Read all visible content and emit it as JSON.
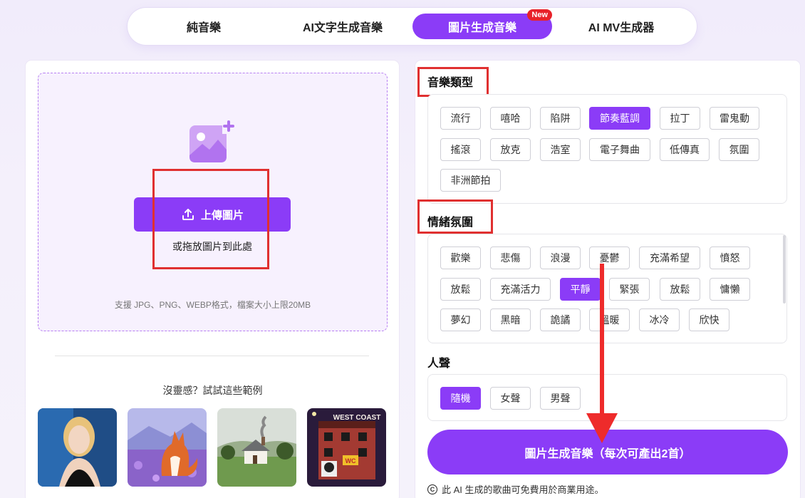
{
  "tabs": [
    {
      "label": "純音樂"
    },
    {
      "label": "AI文字生成音樂"
    },
    {
      "label": "圖片生成音樂",
      "badge": "New"
    },
    {
      "label": "AI MV生成器"
    }
  ],
  "upload": {
    "button_label": "上傳圖片",
    "drag_text": "或拖放圖片到此處",
    "support_text": "支援 JPG、PNG、WEBP格式，檔案大小上限20MB"
  },
  "inspiration": {
    "title": "沒靈感？試試這些範例",
    "thumb4_sign": "WEST COAST",
    "thumb4_tag": "WC"
  },
  "genre": {
    "title": "音樂類型",
    "chips": [
      "流行",
      "嘻哈",
      "陷阱",
      "節奏藍調",
      "拉丁",
      "雷鬼動",
      "搖滾",
      "放克",
      "浩室",
      "電子舞曲",
      "低傳真",
      "氛圍",
      "非洲節拍"
    ],
    "selected": "節奏藍調"
  },
  "mood": {
    "title": "情緒氛圍",
    "chips": [
      "歡樂",
      "悲傷",
      "浪漫",
      "憂鬱",
      "充滿希望",
      "憤怒",
      "放鬆",
      "充滿活力",
      "平靜",
      "緊張",
      "放鬆",
      "慵懶",
      "夢幻",
      "黑暗",
      "詭譎",
      "溫暖",
      "冰冷",
      "欣快"
    ],
    "selected": "平靜"
  },
  "vocal": {
    "title": "人聲",
    "chips": [
      "隨機",
      "女聲",
      "男聲"
    ],
    "selected": "隨機"
  },
  "generate_button": "圖片生成音樂（每次可產出2首）",
  "footer_note": "此 AI 生成的歌曲可免費用於商業用途。",
  "colors": {
    "accent": "#8b3cf7",
    "highlight_box": "#e03030",
    "badge": "#e8222a"
  },
  "icons": [
    "image-plus-icon",
    "upload-icon",
    "copyright-icon",
    "down-arrow-annotation"
  ]
}
